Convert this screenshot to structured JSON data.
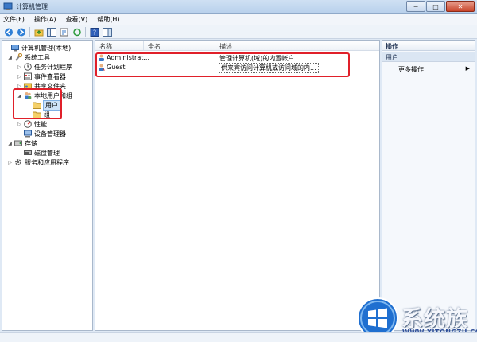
{
  "window": {
    "title": "计算机管理",
    "btn_min": "─",
    "btn_max": "□",
    "btn_close": "✕"
  },
  "menu": [
    "文件(F)",
    "操作(A)",
    "查看(V)",
    "帮助(H)"
  ],
  "toolbar": {
    "icons": [
      "back-arrow-icon",
      "forward-arrow-icon",
      "folder-up-icon",
      "console-tree-icon",
      "properties-icon",
      "refresh-icon",
      "help-icon",
      "pane-icon"
    ]
  },
  "tree": [
    {
      "label": "计算机管理(本地)",
      "level": 0,
      "twisty": "",
      "icon": "computer-icon"
    },
    {
      "label": "系统工具",
      "level": 1,
      "twisty": "◢",
      "icon": "tools-icon"
    },
    {
      "label": "任务计划程序",
      "level": 2,
      "twisty": "▷",
      "icon": "clock-icon"
    },
    {
      "label": "事件查看器",
      "level": 2,
      "twisty": "▷",
      "icon": "event-viewer-icon"
    },
    {
      "label": "共享文件夹",
      "level": 2,
      "twisty": "▷",
      "icon": "shared-folder-icon"
    },
    {
      "label": "本地用户和组",
      "level": 2,
      "twisty": "◢",
      "icon": "users-group-icon"
    },
    {
      "label": "用户",
      "level": 3,
      "twisty": "",
      "icon": "folder-icon",
      "selected": true
    },
    {
      "label": "组",
      "level": 3,
      "twisty": "",
      "icon": "folder-icon"
    },
    {
      "label": "性能",
      "level": 2,
      "twisty": "▷",
      "icon": "performance-icon"
    },
    {
      "label": "设备管理器",
      "level": 2,
      "twisty": "",
      "icon": "device-manager-icon"
    },
    {
      "label": "存储",
      "level": 1,
      "twisty": "◢",
      "icon": "storage-icon"
    },
    {
      "label": "磁盘管理",
      "level": 2,
      "twisty": "",
      "icon": "disk-icon"
    },
    {
      "label": "服务和应用程序",
      "level": 1,
      "twisty": "▷",
      "icon": "services-icon"
    }
  ],
  "list": {
    "columns": [
      "名称",
      "全名",
      "描述"
    ],
    "rows": [
      {
        "name": "Administrat...",
        "fullname": "",
        "desc": "管理计算机(域)的内置帐户"
      },
      {
        "name": "Guest",
        "fullname": "",
        "desc": "供来宾访问计算机或访问域的内..."
      }
    ]
  },
  "actions": {
    "header": "操作",
    "section": "用户",
    "more": "更多操作",
    "arrow": "▶"
  },
  "watermark": {
    "text": "系统族",
    "url": "WWW.XITONGZU.COM"
  },
  "colors": {
    "highlight_box": "#e0202a",
    "selection": "#cde3f8"
  }
}
